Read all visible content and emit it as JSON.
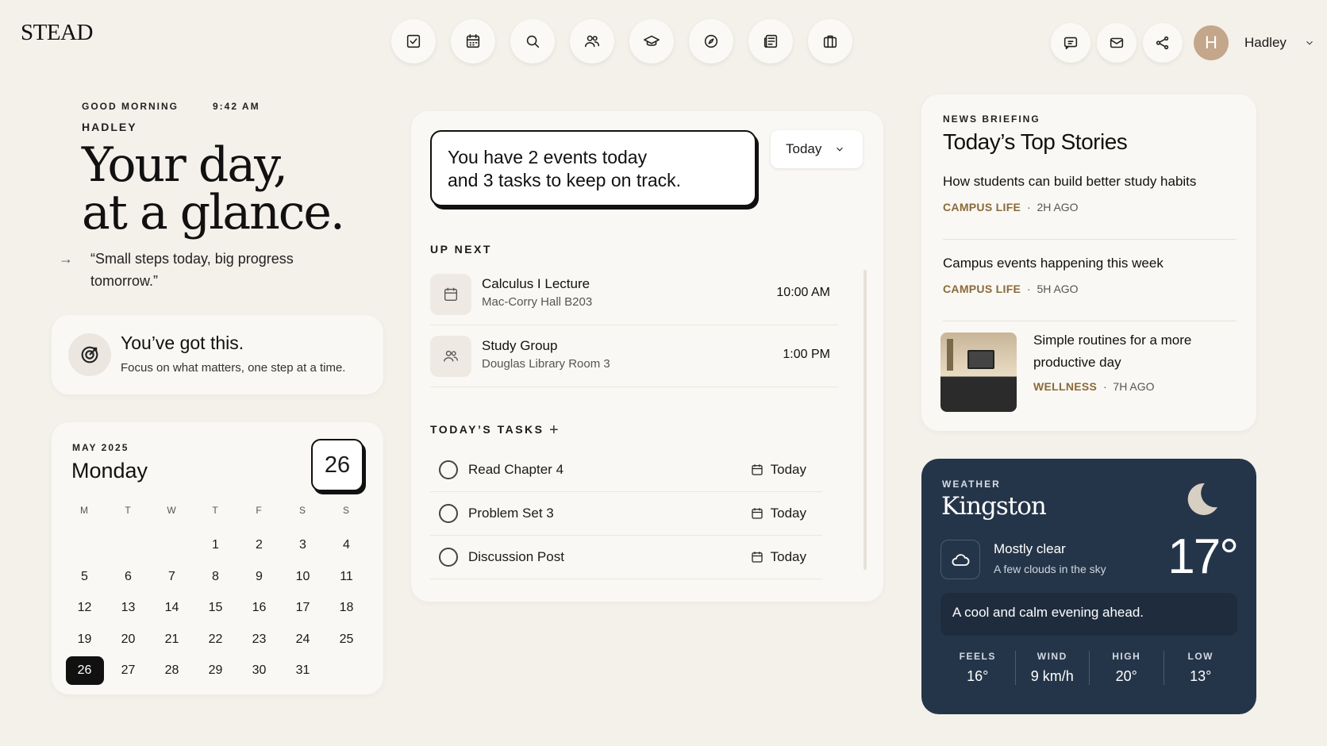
{
  "brand": "STEAD",
  "nav_icons": [
    "tasks-icon",
    "calendar-icon",
    "search-icon",
    "people-icon",
    "graduation-cap-icon",
    "compass-icon",
    "news-icon",
    "briefcase-icon"
  ],
  "user": {
    "initial": "H",
    "name": "Hadley"
  },
  "greeting": {
    "label": "GOOD MORNING",
    "time": "9:42 AM",
    "name": "HADLEY",
    "headline_1": "Your day,",
    "headline_2": "at a glance.",
    "arrow": "→",
    "quote": "“Small steps today, big progress tomorrow.”"
  },
  "motivation": {
    "title": "You’ve got this.",
    "subtitle": "Focus on what matters, one step at a time."
  },
  "calendar": {
    "month": "MAY 2025",
    "weekday": "Monday",
    "date": "26",
    "headers": [
      "M",
      "T",
      "W",
      "T",
      "F",
      "S",
      "S"
    ],
    "days": [
      "",
      "",
      "",
      "1",
      "2",
      "3",
      "4",
      "5",
      "6",
      "7",
      "8",
      "9",
      "10",
      "11",
      "12",
      "13",
      "14",
      "15",
      "16",
      "17",
      "18",
      "19",
      "20",
      "21",
      "22",
      "23",
      "24",
      "25",
      "26",
      "27",
      "28",
      "29",
      "30",
      "31",
      ""
    ],
    "selected": "26"
  },
  "summary": {
    "line1": "You have 2 events today",
    "line2": "and 3 tasks to keep on track.",
    "filter": "Today"
  },
  "up_next": {
    "label": "UP NEXT",
    "events": [
      {
        "name": "Calculus I Lecture",
        "location": "Mac-Corry Hall B203",
        "time": "10:00 AM"
      },
      {
        "name": "Study Group",
        "location": "Douglas Library Room 3",
        "time": "1:00 PM"
      }
    ]
  },
  "tasks": {
    "label": "TODAY’S TASKS",
    "add": "+",
    "items": [
      {
        "name": "Read Chapter 4",
        "due": "Today"
      },
      {
        "name": "Problem Set 3",
        "due": "Today"
      },
      {
        "name": "Discussion Post",
        "due": "Today"
      }
    ]
  },
  "news": {
    "label": "NEWS BRIEFING",
    "title": "Today’s Top Stories",
    "articles": [
      {
        "title": "How students can build better study habits",
        "category": "CAMPUS LIFE",
        "age": "2H AGO"
      },
      {
        "title": "Campus events happening this week",
        "category": "CAMPUS LIFE",
        "age": "5H AGO"
      },
      {
        "title": "Simple routines for a more productive day",
        "category": "WELLNESS",
        "age": "7H AGO"
      }
    ]
  },
  "weather": {
    "label": "WEATHER",
    "city": "Kingston",
    "condition": "Mostly clear",
    "detail": "A few clouds in the sky",
    "temp": "17°",
    "note": "A cool and calm evening ahead.",
    "stats": [
      {
        "label": "FEELS",
        "value": "16°"
      },
      {
        "label": "WIND",
        "value": "9 km/h"
      },
      {
        "label": "HIGH",
        "value": "20°"
      },
      {
        "label": "LOW",
        "value": "13°"
      }
    ]
  },
  "colors": {
    "background": "#f4f0ea",
    "card": "#faf8f4",
    "accent": "#8a6a3a",
    "weather_bg": "#253549",
    "avatar": "#c4a68b"
  }
}
